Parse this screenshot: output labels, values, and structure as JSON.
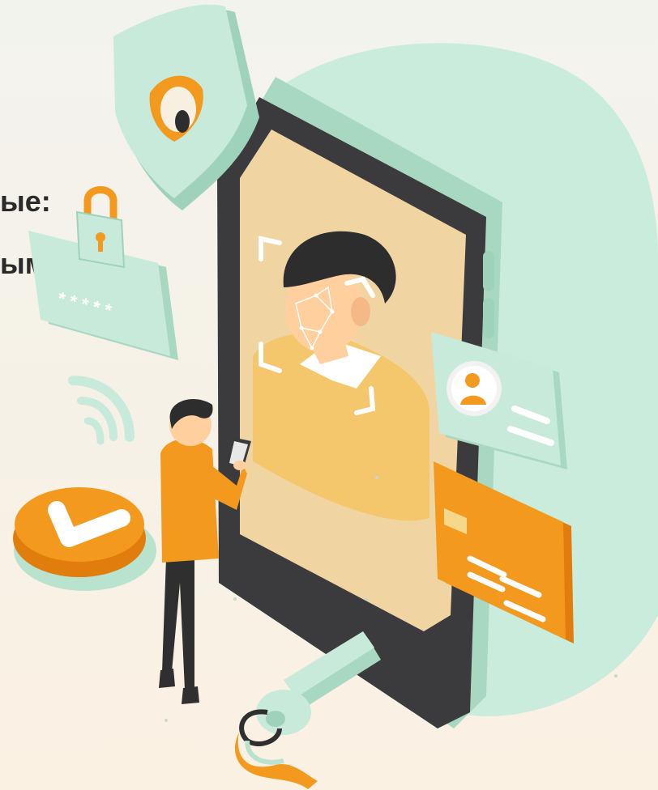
{
  "headline": {
    "line1": "ые:",
    "line2": "ым»"
  },
  "lock": {
    "password_mask": "* * * * *"
  },
  "colors": {
    "mint": "#c8eadb",
    "mint_dark": "#9fd2bb",
    "orange": "#f39a1e",
    "orange_dark": "#e07d0c",
    "phone_frame": "#3a3a3c",
    "screen": "#f2d7a4",
    "skin": "#ffcf9e",
    "hair": "#2d2d2d"
  },
  "icons": [
    "shield-eye-icon",
    "padlock-icon",
    "wifi-signal-icon",
    "checkmark-button-icon",
    "user-profile-icon",
    "credit-card-icon",
    "key-icon",
    "face-scan-icon"
  ]
}
